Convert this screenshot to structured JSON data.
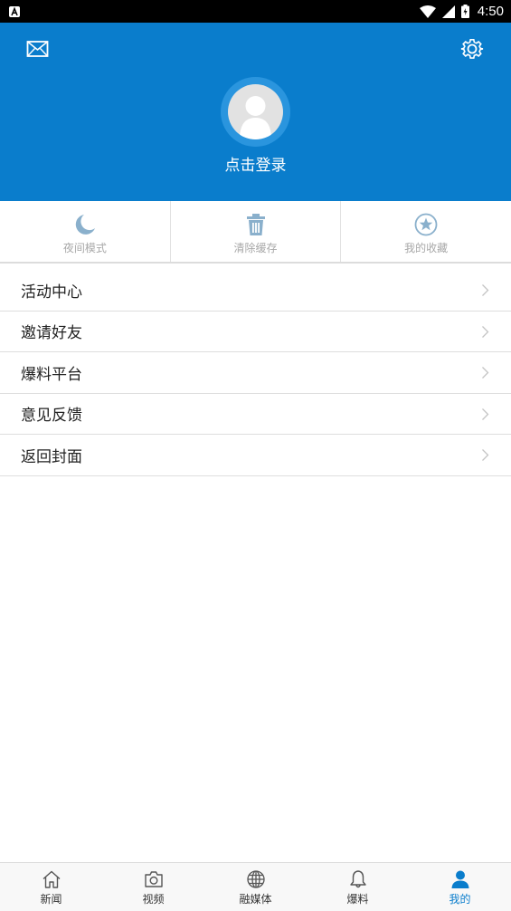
{
  "status_bar": {
    "time": "4:50",
    "notification_icon": "a-notification-icon",
    "icons": [
      "wifi-icon",
      "signal-icon",
      "battery-icon"
    ]
  },
  "header": {
    "background_color": "#0a7dcc",
    "mail_icon": "mail-icon",
    "settings_icon": "gear-icon",
    "avatar_icon": "default-avatar-icon",
    "login_label": "点击登录"
  },
  "quick_actions": [
    {
      "label": "夜间模式",
      "icon": "moon-icon"
    },
    {
      "label": "清除缓存",
      "icon": "trash-icon"
    },
    {
      "label": "我的收藏",
      "icon": "star-icon"
    }
  ],
  "menu": [
    {
      "label": "活动中心"
    },
    {
      "label": "邀请好友"
    },
    {
      "label": "爆料平台"
    },
    {
      "label": "意见反馈"
    },
    {
      "label": "返回封面"
    }
  ],
  "bottom_nav": {
    "items": [
      {
        "label": "新闻",
        "icon": "home-icon"
      },
      {
        "label": "视频",
        "icon": "camera-icon"
      },
      {
        "label": "融媒体",
        "icon": "globe-icon"
      },
      {
        "label": "爆料",
        "icon": "bell-icon"
      },
      {
        "label": "我的",
        "icon": "user-icon"
      }
    ],
    "active_index": 4,
    "active_color": "#0a7dcc"
  }
}
